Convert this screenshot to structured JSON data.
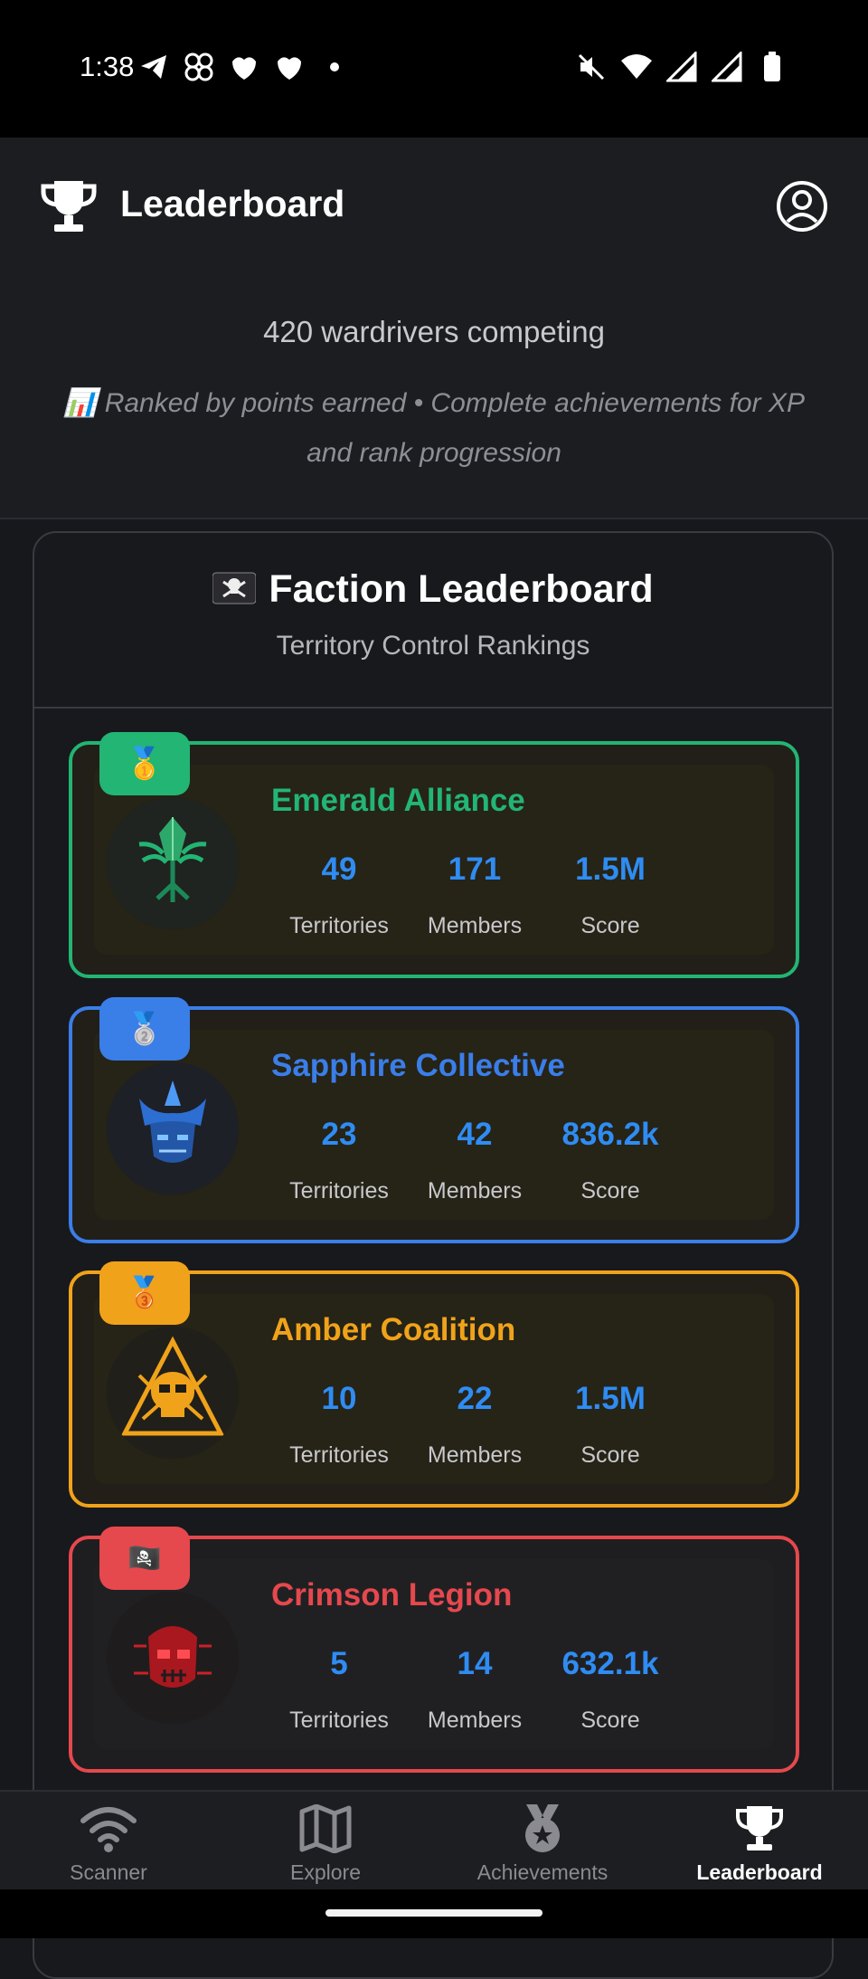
{
  "status_bar": {
    "time": "1:38",
    "left_icons": [
      "telegram-icon",
      "pinwheel-icon",
      "bird-icon",
      "bird-icon",
      "dot-icon"
    ],
    "right_icons": [
      "mute-icon",
      "wifi-icon",
      "signal-roaming-icon",
      "signal-icon",
      "battery-icon"
    ]
  },
  "header": {
    "title": "Leaderboard",
    "competitor_count": "420 wardrivers competing",
    "ranking_note": "📊 Ranked by points earned • Complete achievements for XP and rank progression"
  },
  "faction_panel": {
    "title": "Faction Leaderboard",
    "subtitle": "Territory Control Rankings",
    "stat_labels": {
      "territories": "Territories",
      "members": "Members",
      "score": "Score"
    },
    "factions": [
      {
        "rank_badge": "🥇",
        "name": "Emerald Alliance",
        "color": "#22b573",
        "territories": "49",
        "members": "171",
        "score": "1.5M"
      },
      {
        "rank_badge": "🥈",
        "name": "Sapphire Collective",
        "color": "#3a7ee8",
        "territories": "23",
        "members": "42",
        "score": "836.2k"
      },
      {
        "rank_badge": "🥉",
        "name": "Amber Coalition",
        "color": "#f0a31a",
        "territories": "10",
        "members": "22",
        "score": "1.5M"
      },
      {
        "rank_badge": "🏴‍☠️",
        "name": "Crimson Legion",
        "color": "#e5484d",
        "territories": "5",
        "members": "14",
        "score": "632.1k"
      }
    ]
  },
  "bottom_nav": {
    "items": [
      {
        "label": "Scanner",
        "icon": "wifi-icon"
      },
      {
        "label": "Explore",
        "icon": "map-icon"
      },
      {
        "label": "Achievements",
        "icon": "medal-icon"
      },
      {
        "label": "Leaderboard",
        "icon": "trophy-icon",
        "active": true
      }
    ]
  },
  "colors": {
    "background": "#17181c",
    "stat_value": "#2f8cf2",
    "text_primary": "#ffffff"
  }
}
